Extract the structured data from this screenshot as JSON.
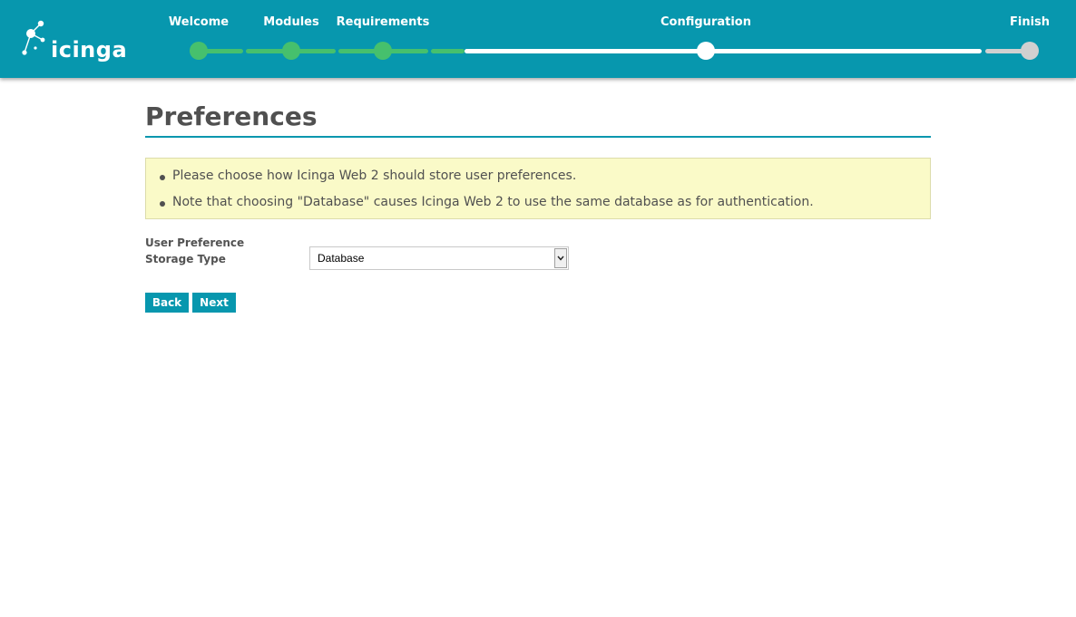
{
  "header": {
    "brand": "icinga",
    "steps": [
      {
        "label": "Welcome",
        "state": "complete"
      },
      {
        "label": "Modules",
        "state": "complete"
      },
      {
        "label": "Requirements",
        "state": "complete"
      },
      {
        "label": "Configuration",
        "state": "current"
      },
      {
        "label": "Finish",
        "state": "pending"
      }
    ]
  },
  "colors": {
    "accent": "#0797ae",
    "complete": "#46c06d",
    "current": "#ffffff",
    "pending": "#d0d0d0",
    "notice_bg": "#fafac8"
  },
  "main": {
    "title": "Preferences",
    "notices": [
      "Please choose how Icinga Web 2 should store user preferences.",
      "Note that choosing \"Database\" causes Icinga Web 2 to use the same database as for authentication."
    ],
    "form": {
      "storage_type_label": "User Preference Storage Type",
      "storage_type_value": "Database"
    },
    "buttons": {
      "back": "Back",
      "next": "Next"
    }
  }
}
